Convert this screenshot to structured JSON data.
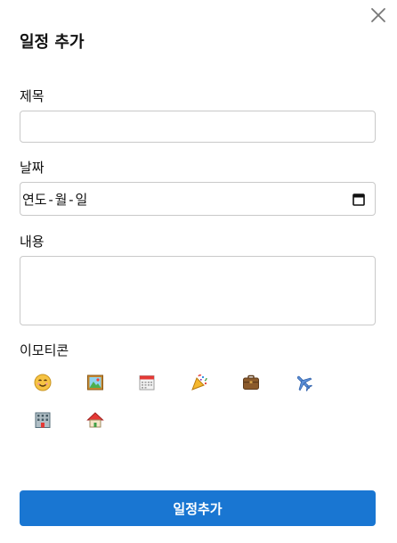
{
  "dialog": {
    "title": "일정 추가",
    "close_icon": "close-icon"
  },
  "form": {
    "title_label": "제목",
    "title_value": "",
    "date_label": "날짜",
    "date_placeholder": "연도-월-일",
    "content_label": "내용",
    "content_value": "",
    "emoticon_label": "이모티콘"
  },
  "emoticons": [
    {
      "name": "smiley-face",
      "glyph": "😊"
    },
    {
      "name": "picture-frame",
      "glyph": "🖼"
    },
    {
      "name": "calendar",
      "glyph": "📅"
    },
    {
      "name": "party-popper",
      "glyph": "🎉"
    },
    {
      "name": "briefcase",
      "glyph": "💼"
    },
    {
      "name": "airplane",
      "glyph": "✈"
    },
    {
      "name": "office-building",
      "glyph": "🏢"
    },
    {
      "name": "house",
      "glyph": "🏠"
    }
  ],
  "submit": {
    "label": "일정추가",
    "color": "#1976d2"
  }
}
